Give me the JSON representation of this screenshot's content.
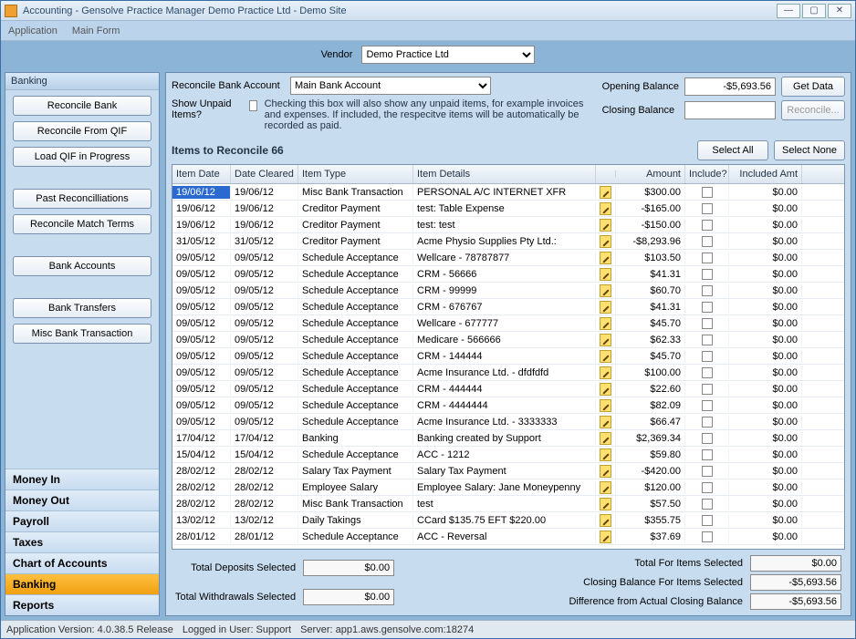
{
  "window": {
    "title": "Accounting - Gensolve Practice Manager       Demo Practice Ltd - Demo Site"
  },
  "menu": {
    "application": "Application",
    "mainform": "Main Form"
  },
  "vendor": {
    "label": "Vendor",
    "selected": "Demo Practice Ltd"
  },
  "sidebar": {
    "heading": "Banking",
    "buttons": {
      "reconcile_bank": "Reconcile Bank",
      "reconcile_qif": "Reconcile From QIF",
      "load_qif": "Load QIF in Progress",
      "past_recon": "Past Reconcilliations",
      "match_terms": "Reconcile Match Terms",
      "bank_accounts": "Bank Accounts",
      "bank_transfers": "Bank Transfers",
      "misc_bank": "Misc Bank Transaction"
    },
    "nav": {
      "money_in": "Money In",
      "money_out": "Money Out",
      "payroll": "Payroll",
      "taxes": "Taxes",
      "coa": "Chart of Accounts",
      "banking": "Banking",
      "reports": "Reports"
    }
  },
  "form": {
    "account_label": "Reconcile Bank Account",
    "account_selected": "Main Bank Account",
    "unpaid_label": "Show Unpaid Items?",
    "unpaid_help": "Checking this box will also show any unpaid items, for example invoices and expenses. If included, the respecitve items will be automatically be recorded as paid.",
    "opening_label": "Opening Balance",
    "opening_value": "-$5,693.56",
    "closing_label": "Closing Balance",
    "closing_value": "",
    "get_data": "Get Data",
    "reconcile": "Reconcile...",
    "items_label": "Items to Reconcile 66",
    "select_all": "Select All",
    "select_none": "Select None"
  },
  "grid": {
    "headers": {
      "item_date": "Item Date",
      "date_cleared": "Date Cleared",
      "item_type": "Item Type",
      "item_details": "Item Details",
      "amount": "Amount",
      "include": "Include?",
      "included_amt": "Included Amt"
    },
    "rows": [
      {
        "item_date": "19/06/12",
        "date_cleared": "19/06/12",
        "item_type": "Misc Bank Transaction",
        "item_details": "PERSONAL A/C INTERNET XFR",
        "amount": "$300.00",
        "included_amt": "$0.00"
      },
      {
        "item_date": "19/06/12",
        "date_cleared": "19/06/12",
        "item_type": "Creditor Payment",
        "item_details": "test:   Table Expense",
        "amount": "-$165.00",
        "included_amt": "$0.00"
      },
      {
        "item_date": "19/06/12",
        "date_cleared": "19/06/12",
        "item_type": "Creditor Payment",
        "item_details": "test:   test",
        "amount": "-$150.00",
        "included_amt": "$0.00"
      },
      {
        "item_date": "31/05/12",
        "date_cleared": "31/05/12",
        "item_type": "Creditor Payment",
        "item_details": "Acme Physio Supplies Pty Ltd.:",
        "amount": "-$8,293.96",
        "included_amt": "$0.00"
      },
      {
        "item_date": "09/05/12",
        "date_cleared": "09/05/12",
        "item_type": "Schedule Acceptance",
        "item_details": "Wellcare - 78787877",
        "amount": "$103.50",
        "included_amt": "$0.00"
      },
      {
        "item_date": "09/05/12",
        "date_cleared": "09/05/12",
        "item_type": "Schedule Acceptance",
        "item_details": "CRM - 56666",
        "amount": "$41.31",
        "included_amt": "$0.00"
      },
      {
        "item_date": "09/05/12",
        "date_cleared": "09/05/12",
        "item_type": "Schedule Acceptance",
        "item_details": "CRM - 99999",
        "amount": "$60.70",
        "included_amt": "$0.00"
      },
      {
        "item_date": "09/05/12",
        "date_cleared": "09/05/12",
        "item_type": "Schedule Acceptance",
        "item_details": "CRM - 676767",
        "amount": "$41.31",
        "included_amt": "$0.00"
      },
      {
        "item_date": "09/05/12",
        "date_cleared": "09/05/12",
        "item_type": "Schedule Acceptance",
        "item_details": "Wellcare - 677777",
        "amount": "$45.70",
        "included_amt": "$0.00"
      },
      {
        "item_date": "09/05/12",
        "date_cleared": "09/05/12",
        "item_type": "Schedule Acceptance",
        "item_details": "Medicare - 566666",
        "amount": "$62.33",
        "included_amt": "$0.00"
      },
      {
        "item_date": "09/05/12",
        "date_cleared": "09/05/12",
        "item_type": "Schedule Acceptance",
        "item_details": "CRM - 144444",
        "amount": "$45.70",
        "included_amt": "$0.00"
      },
      {
        "item_date": "09/05/12",
        "date_cleared": "09/05/12",
        "item_type": "Schedule Acceptance",
        "item_details": "Acme Insurance Ltd. - dfdfdfd",
        "amount": "$100.00",
        "included_amt": "$0.00"
      },
      {
        "item_date": "09/05/12",
        "date_cleared": "09/05/12",
        "item_type": "Schedule Acceptance",
        "item_details": "CRM - 444444",
        "amount": "$22.60",
        "included_amt": "$0.00"
      },
      {
        "item_date": "09/05/12",
        "date_cleared": "09/05/12",
        "item_type": "Schedule Acceptance",
        "item_details": "CRM - 4444444",
        "amount": "$82.09",
        "included_amt": "$0.00"
      },
      {
        "item_date": "09/05/12",
        "date_cleared": "09/05/12",
        "item_type": "Schedule Acceptance",
        "item_details": "Acme Insurance Ltd. - 3333333",
        "amount": "$66.47",
        "included_amt": "$0.00"
      },
      {
        "item_date": "17/04/12",
        "date_cleared": "17/04/12",
        "item_type": "Banking",
        "item_details": "Banking created by Support",
        "amount": "$2,369.34",
        "included_amt": "$0.00"
      },
      {
        "item_date": "15/04/12",
        "date_cleared": "15/04/12",
        "item_type": "Schedule Acceptance",
        "item_details": "ACC - 1212",
        "amount": "$59.80",
        "included_amt": "$0.00"
      },
      {
        "item_date": "28/02/12",
        "date_cleared": "28/02/12",
        "item_type": "Salary Tax Payment",
        "item_details": "Salary Tax Payment",
        "amount": "-$420.00",
        "included_amt": "$0.00"
      },
      {
        "item_date": "28/02/12",
        "date_cleared": "28/02/12",
        "item_type": "Employee Salary",
        "item_details": "Employee Salary: Jane Moneypenny",
        "amount": "$120.00",
        "included_amt": "$0.00"
      },
      {
        "item_date": "28/02/12",
        "date_cleared": "28/02/12",
        "item_type": "Misc Bank Transaction",
        "item_details": "test",
        "amount": "$57.50",
        "included_amt": "$0.00"
      },
      {
        "item_date": "13/02/12",
        "date_cleared": "13/02/12",
        "item_type": "Daily Takings",
        "item_details": "CCard $135.75 EFT $220.00",
        "amount": "$355.75",
        "included_amt": "$0.00"
      },
      {
        "item_date": "28/01/12",
        "date_cleared": "28/01/12",
        "item_type": "Schedule Acceptance",
        "item_details": "ACC - Reversal",
        "amount": "$37.69",
        "included_amt": "$0.00"
      }
    ]
  },
  "totals": {
    "deposits_label": "Total Deposits Selected",
    "deposits_value": "$0.00",
    "withdrawals_label": "Total Withdrawals Selected",
    "withdrawals_value": "$0.00",
    "items_label": "Total For Items Selected",
    "items_value": "$0.00",
    "closing_label": "Closing Balance For Items Selected",
    "closing_value": "-$5,693.56",
    "diff_label": "Difference from Actual Closing Balance",
    "diff_value": "-$5,693.56"
  },
  "status": {
    "version": "Application Version: 4.0.38.5 Release",
    "user": "Logged in User: Support",
    "server": "Server: app1.aws.gensolve.com:18274"
  }
}
